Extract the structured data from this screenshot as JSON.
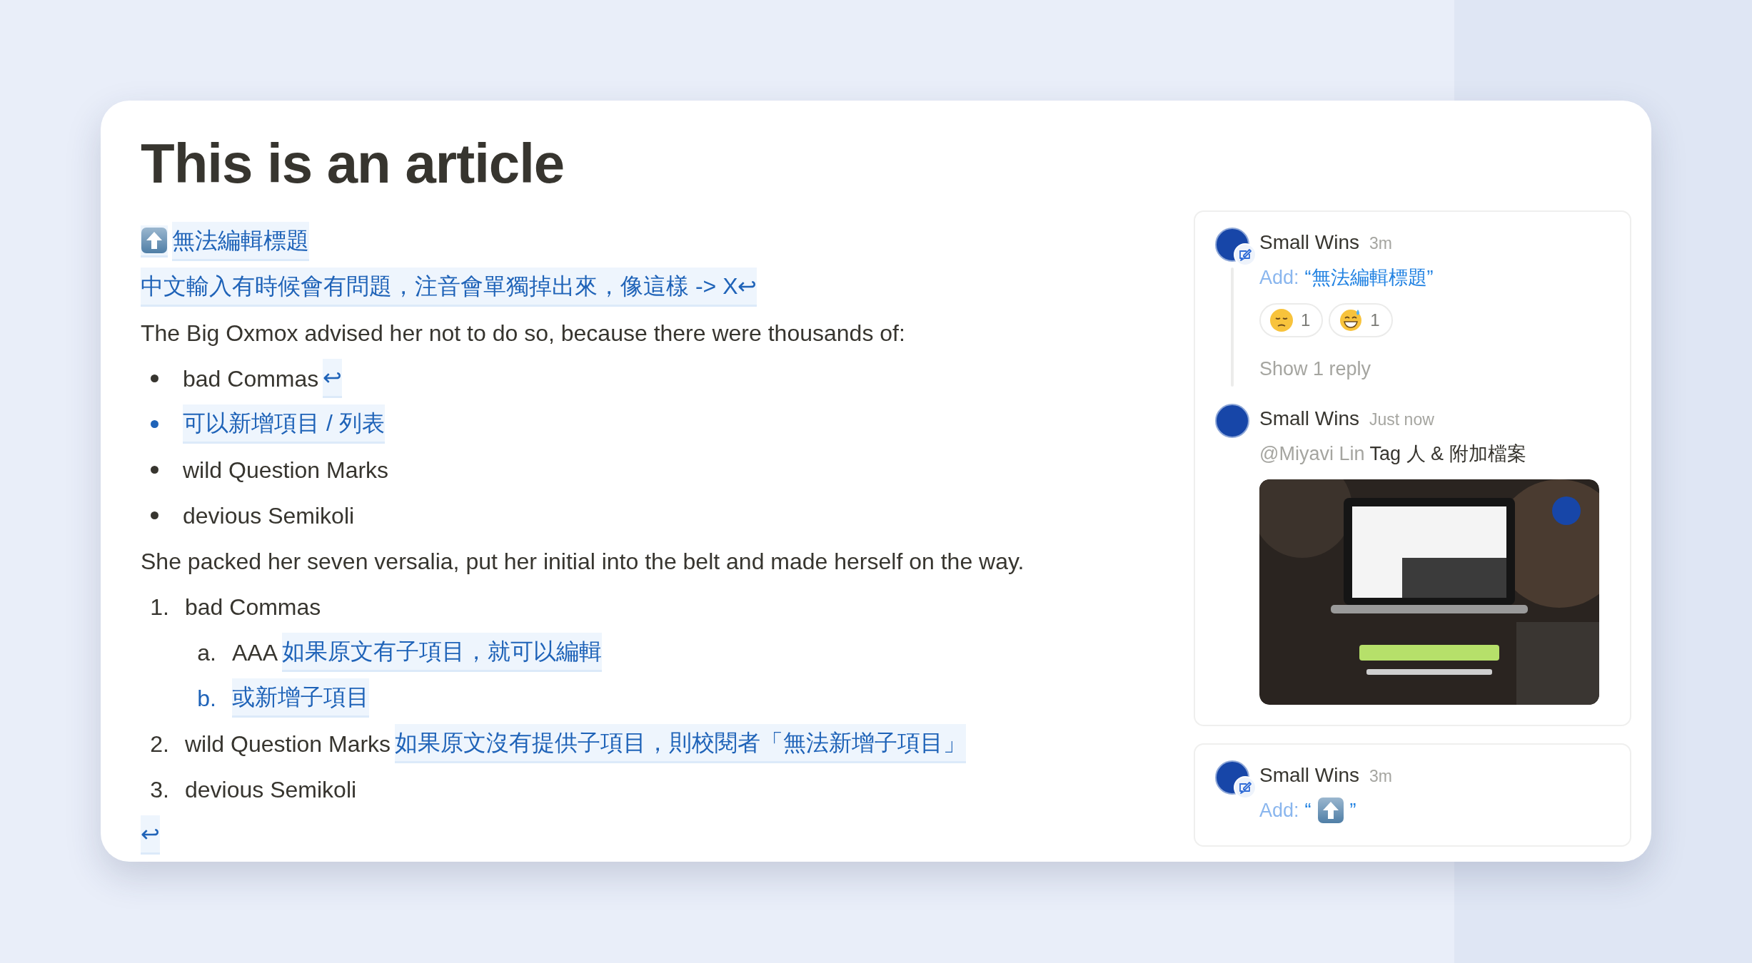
{
  "title": "This is an article",
  "blocks": [
    {
      "kind": "line",
      "segments": [
        {
          "kind": "up-icon",
          "suggested": true
        },
        {
          "kind": "text",
          "text": "無法編輯標題",
          "suggested": true
        }
      ]
    },
    {
      "kind": "line",
      "segments": [
        {
          "kind": "text",
          "text": "中文輸入有時候會有問題，注音會單獨掉出來，像這樣 -> X↩",
          "suggested": true
        }
      ]
    },
    {
      "kind": "line",
      "segments": [
        {
          "kind": "text",
          "text": "The Big Oxmox advised her not to do so, because there were thousands of:",
          "suggested": false
        }
      ]
    },
    {
      "kind": "bullets",
      "items": [
        {
          "suggested": false,
          "segments": [
            {
              "kind": "text",
              "text": "bad Commas",
              "suggested": false
            },
            {
              "kind": "text",
              "text": "↩",
              "suggested": true
            }
          ]
        },
        {
          "suggested": true,
          "segments": [
            {
              "kind": "text",
              "text": "可以新增項目 / 列表",
              "suggested": true
            }
          ]
        },
        {
          "suggested": false,
          "segments": [
            {
              "kind": "text",
              "text": "wild Question Marks",
              "suggested": false
            }
          ]
        },
        {
          "suggested": false,
          "segments": [
            {
              "kind": "text",
              "text": "devious Semikoli",
              "suggested": false
            }
          ]
        }
      ]
    },
    {
      "kind": "line",
      "segments": [
        {
          "kind": "text",
          "text": "She packed her seven versalia, put her initial into the belt and made herself on the way.",
          "suggested": false
        }
      ]
    },
    {
      "kind": "numbered",
      "items": [
        {
          "marker": "1.",
          "suggested": false,
          "segments": [
            {
              "kind": "text",
              "text": "bad Commas",
              "suggested": false
            }
          ],
          "children": [
            {
              "marker": "a.",
              "suggested": false,
              "segments": [
                {
                  "kind": "text",
                  "text": "AAA",
                  "suggested": false
                },
                {
                  "kind": "text",
                  "text": "如果原文有子項目，就可以編輯",
                  "suggested": true
                }
              ]
            },
            {
              "marker": "b.",
              "suggested": true,
              "segments": [
                {
                  "kind": "text",
                  "text": "或新增子項目",
                  "suggested": true
                }
              ]
            }
          ]
        },
        {
          "marker": "2.",
          "suggested": false,
          "segments": [
            {
              "kind": "text",
              "text": "wild Question Marks",
              "suggested": false
            },
            {
              "kind": "text",
              "text": "如果原文沒有提供子項目，則校閱者「無法新增子項目」",
              "suggested": true
            }
          ]
        },
        {
          "marker": "3.",
          "suggested": false,
          "segments": [
            {
              "kind": "text",
              "text": "devious Semikoli",
              "suggested": false
            }
          ]
        }
      ]
    },
    {
      "kind": "line",
      "segments": [
        {
          "kind": "text",
          "text": "↩",
          "suggested": true
        }
      ]
    }
  ],
  "threads": [
    {
      "comments": [
        {
          "author": "Small Wins",
          "time": "3m",
          "kind": "suggestion",
          "label": "Add:",
          "quote": [
            {
              "kind": "text",
              "text": "“無法編輯標題”"
            }
          ],
          "reactions": [
            {
              "kind": "pensive",
              "count": "1"
            },
            {
              "kind": "sweat-smile",
              "count": "1"
            }
          ],
          "replies": "Show 1 reply"
        },
        {
          "author": "Small Wins",
          "time": "Just now",
          "kind": "message",
          "mention": "@Miyavi Lin",
          "text": "Tag 人 & 附加檔案"
        }
      ]
    },
    {
      "comments": [
        {
          "author": "Small Wins",
          "time": "3m",
          "kind": "suggestion",
          "label": "Add:",
          "quote": [
            {
              "kind": "text",
              "text": "“"
            },
            {
              "kind": "up-icon"
            },
            {
              "kind": "text",
              "text": " ”"
            }
          ]
        }
      ]
    }
  ]
}
